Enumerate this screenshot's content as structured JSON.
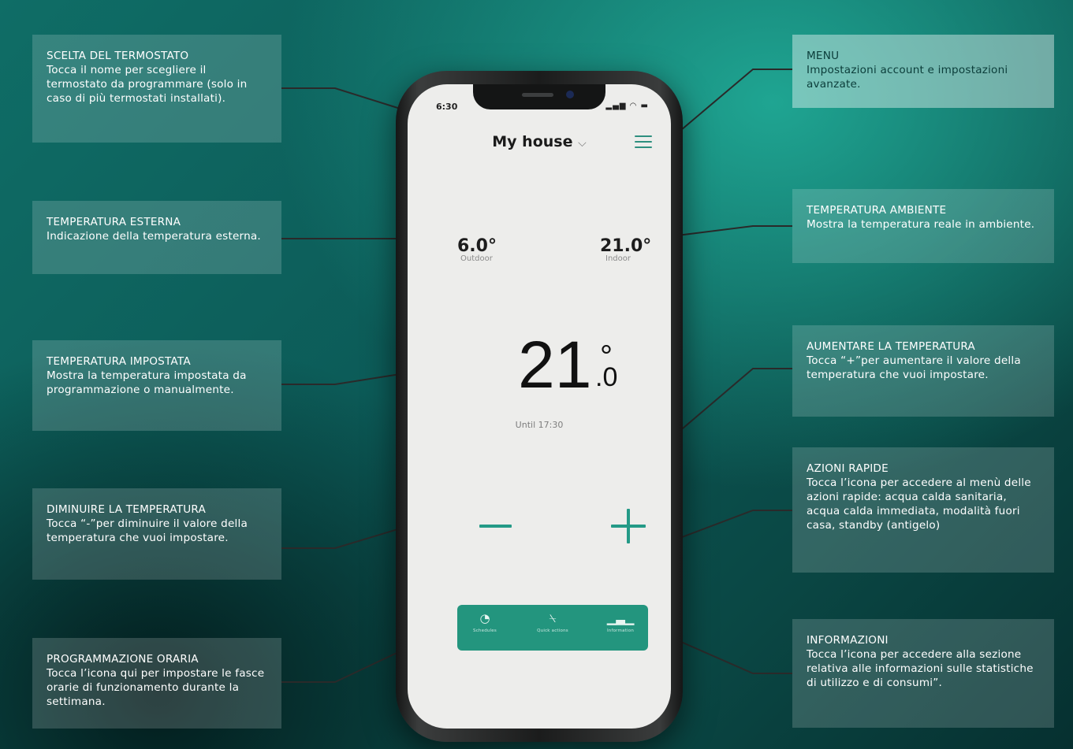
{
  "colors": {
    "accent": "#249a87",
    "callout_line": "#2a2a2a",
    "box_text": "#ffffff"
  },
  "callouts": {
    "thermostat": {
      "title": "SCELTA DEL TERMOSTATO",
      "text": "Tocca il nome per scegliere il termostato da programmare (solo in caso di più termostati installati)."
    },
    "outdoor": {
      "title": "TEMPERATURA ESTERNA",
      "text": "Indicazione della temperatura esterna."
    },
    "setpoint": {
      "title": "TEMPERATURA IMPOSTATA",
      "text": "Mostra la temperatura impostata da programmazione o manualmente."
    },
    "decrease": {
      "title": "DIMINUIRE LA TEMPERATURA",
      "text": "Tocca “-”per diminuire il valore della temperatura che vuoi impostare."
    },
    "schedule": {
      "title": "PROGRAMMAZIONE ORARIA",
      "text": "Tocca l’icona qui per impostare le fasce orarie di funzionamento durante la settimana."
    },
    "menu": {
      "title": "MENU",
      "text": "Impostazioni account e impostazioni avanzate."
    },
    "indoor": {
      "title": "TEMPERATURA AMBIENTE",
      "text": "Mostra la temperatura reale in ambiente."
    },
    "increase": {
      "title": "AUMENTARE LA TEMPERATURA",
      "text": "Tocca “+”per aumentare il valore della temperatura che vuoi impostare."
    },
    "quick_actions": {
      "title": "AZIONI RAPIDE",
      "text": "Tocca l’icona per accedere al menù delle azioni rapide: acqua calda sanitaria, acqua calda immediata, modalità fuori casa, standby (antigelo)"
    },
    "info": {
      "title": "INFORMAZIONI",
      "text": "Tocca l’icona per accedere alla sezione relativa alle informazioni sulle statistiche di utilizzo e di consumi”."
    }
  },
  "phone": {
    "status_time": "6:30",
    "house_name": "My house",
    "chevron": "⌵",
    "outdoor_value": "6.0°",
    "outdoor_label": "Outdoor",
    "indoor_value": "21.0°",
    "indoor_label": "Indoor",
    "setpoint_whole": "21",
    "setpoint_degree": "°",
    "setpoint_decimal": ".0",
    "until": "Until 17:30",
    "tabs": [
      {
        "icon": "schedule-icon",
        "glyph": "◔",
        "label": "Schedules"
      },
      {
        "icon": "quick-actions-icon",
        "glyph": "⍀",
        "label": "Quick actions"
      },
      {
        "icon": "statistics-icon",
        "glyph": "▁▃▁",
        "label": "Information"
      }
    ]
  }
}
